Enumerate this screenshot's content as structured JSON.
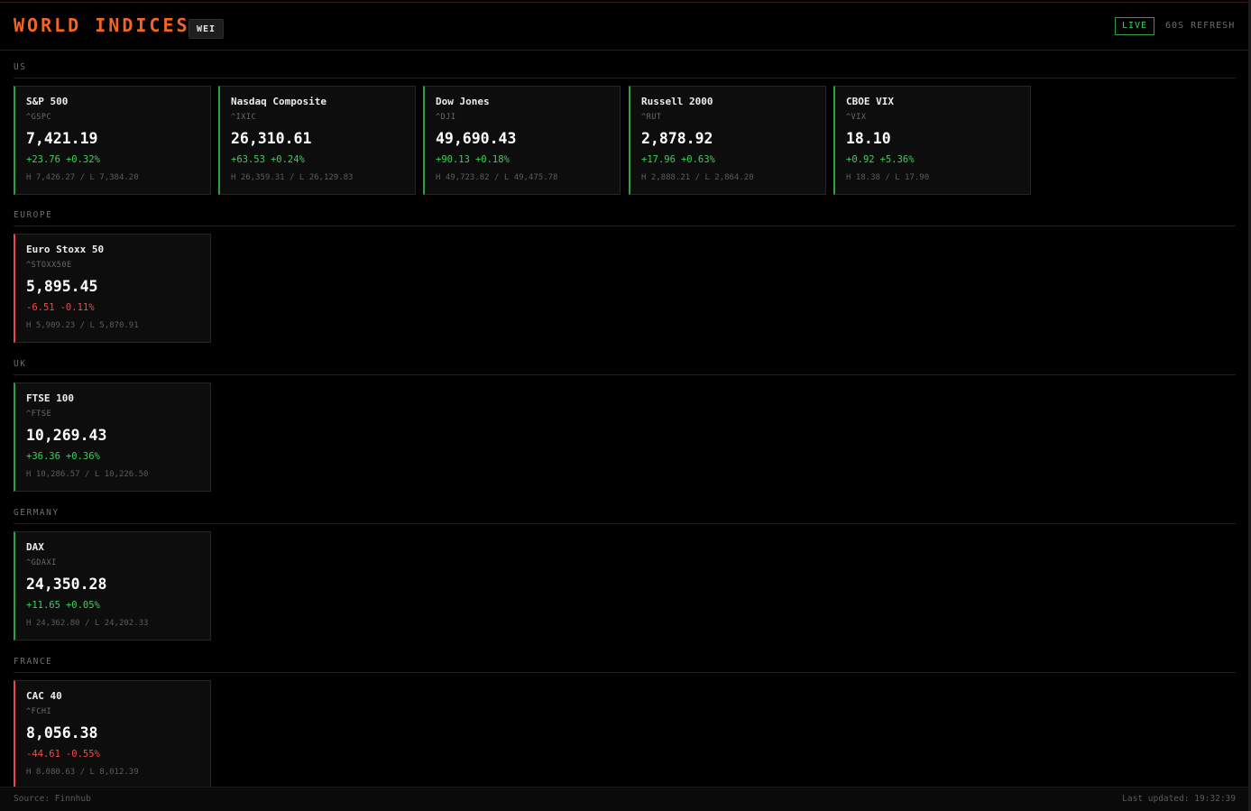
{
  "header": {
    "title": "WORLD INDICES",
    "badge": "WEI",
    "live_label": "LIVE",
    "refresh_label": "60S REFRESH"
  },
  "sections": [
    {
      "title": "US",
      "cards": [
        {
          "name": "S&P 500",
          "symbol": "^GSPC",
          "price": "7,421.19",
          "change": "+23.76",
          "change_pct": "+0.32%",
          "range": "H 7,426.27 / L 7,384.20",
          "direction": "up"
        },
        {
          "name": "Nasdaq Composite",
          "symbol": "^IXIC",
          "price": "26,310.61",
          "change": "+63.53",
          "change_pct": "+0.24%",
          "range": "H 26,359.31 / L 26,129.83",
          "direction": "up"
        },
        {
          "name": "Dow Jones",
          "symbol": "^DJI",
          "price": "49,690.43",
          "change": "+90.13",
          "change_pct": "+0.18%",
          "range": "H 49,723.82 / L 49,475.78",
          "direction": "up"
        },
        {
          "name": "Russell 2000",
          "symbol": "^RUT",
          "price": "2,878.92",
          "change": "+17.96",
          "change_pct": "+0.63%",
          "range": "H 2,888.21 / L 2,864.20",
          "direction": "up"
        },
        {
          "name": "CBOE VIX",
          "symbol": "^VIX",
          "price": "18.10",
          "change": "+0.92",
          "change_pct": "+5.36%",
          "range": "H 18.38 / L 17.90",
          "direction": "up"
        }
      ]
    },
    {
      "title": "EUROPE",
      "cards": [
        {
          "name": "Euro Stoxx 50",
          "symbol": "^STOXX50E",
          "price": "5,895.45",
          "change": "-6.51",
          "change_pct": "-0.11%",
          "range": "H 5,909.23 / L 5,870.91",
          "direction": "down"
        }
      ]
    },
    {
      "title": "UK",
      "cards": [
        {
          "name": "FTSE 100",
          "symbol": "^FTSE",
          "price": "10,269.43",
          "change": "+36.36",
          "change_pct": "+0.36%",
          "range": "H 10,286.57 / L 10,226.50",
          "direction": "up"
        }
      ]
    },
    {
      "title": "GERMANY",
      "cards": [
        {
          "name": "DAX",
          "symbol": "^GDAXI",
          "price": "24,350.28",
          "change": "+11.65",
          "change_pct": "+0.05%",
          "range": "H 24,362.80 / L 24,202.33",
          "direction": "up"
        }
      ]
    },
    {
      "title": "FRANCE",
      "cards": [
        {
          "name": "CAC 40",
          "symbol": "^FCHI",
          "price": "8,056.38",
          "change": "-44.61",
          "change_pct": "-0.55%",
          "range": "H 8,080.63 / L 8,012.39",
          "direction": "down"
        }
      ]
    }
  ],
  "footer": {
    "source": "Source: Finnhub",
    "last_updated": "Last updated: 19:32:39"
  },
  "colors": {
    "accent": "#f26522",
    "positive": "#3ecf5a",
    "negative": "#f04b4b",
    "background": "#000000",
    "card_background": "#0d0d0d"
  }
}
